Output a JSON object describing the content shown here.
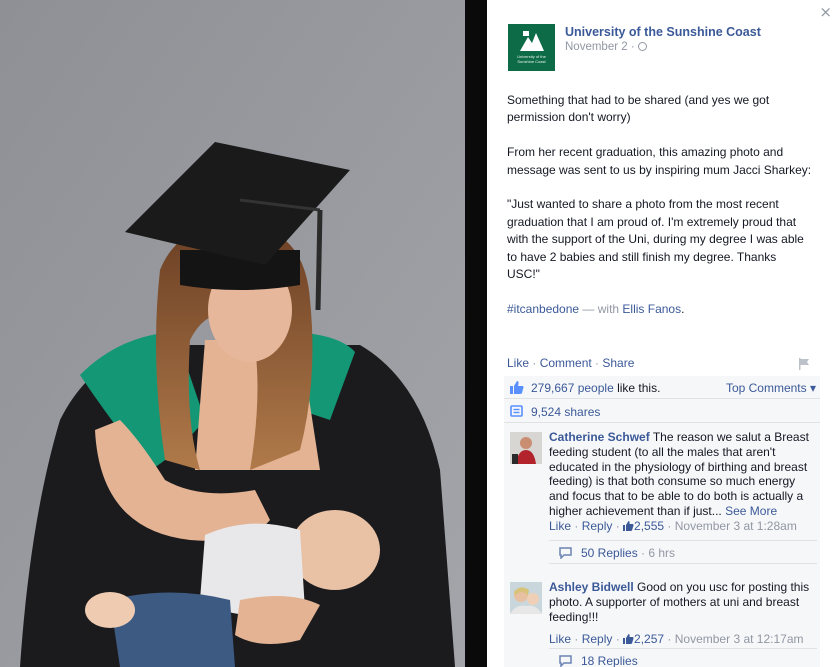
{
  "window": {
    "close_glyph": "×"
  },
  "page": {
    "name": "University of the Sunshine Coast",
    "logo_text": "University of the\nSunshine Coast",
    "logo_color": "#0d6b47"
  },
  "post": {
    "date": "November 2 ·",
    "paragraphs": [
      "Something that had to be shared (and yes we got permission don't worry)",
      "From her recent graduation, this amazing photo and message was sent to us by inspiring mum Jacci Sharkey:",
      "\"Just wanted to share a photo from the most recent graduation that I am proud of. I'm extremely proud that with the support of the Uni, during my degree I was able to have 2 babies and still finish my degree. Thanks USC!\""
    ],
    "hashtag": "#itcanbedone",
    "with_text": " — with ",
    "tagged": "Ellis Fanos",
    "tagged_suffix": "."
  },
  "actions": {
    "like": "Like",
    "comment": "Comment",
    "share": "Share",
    "separator": " · "
  },
  "ufi": {
    "likes_count": "279,667 people",
    "likes_suffix": " like this.",
    "top_comments": "Top Comments ▾",
    "shares": "9,524 shares"
  },
  "comments": [
    {
      "author": "Catherine Schwef",
      "text": " The reason we salut a Breast feeding student (to all the males that aren't educated in the physiology of birthing and breast feeding) is that both consume so much energy and focus that to be able to do both is actually a higher achievement than if just...",
      "see_more": " See More",
      "like": "Like",
      "reply": "Reply",
      "likes": "2,555",
      "time": "November 3 at 1:28am",
      "replies": "50 Replies",
      "replies_time": " · 6 hrs"
    },
    {
      "author": "Ashley Bidwell",
      "text": " Good on you usc for posting this photo. A supporter of mothers at uni and breast feeding!!!",
      "like": "Like",
      "reply": "Reply",
      "likes": "2,257",
      "time": "November 3 at 12:17am",
      "replies": "18 Replies"
    }
  ],
  "colors": {
    "link": "#3b5998",
    "muted": "#9197a3",
    "text": "#141823",
    "ufi_bg": "#f6f7f9"
  },
  "icons": [
    "close-icon",
    "globe-icon",
    "flag-icon",
    "thumbs-up-icon",
    "share-icon",
    "reply-bubble-icon"
  ]
}
